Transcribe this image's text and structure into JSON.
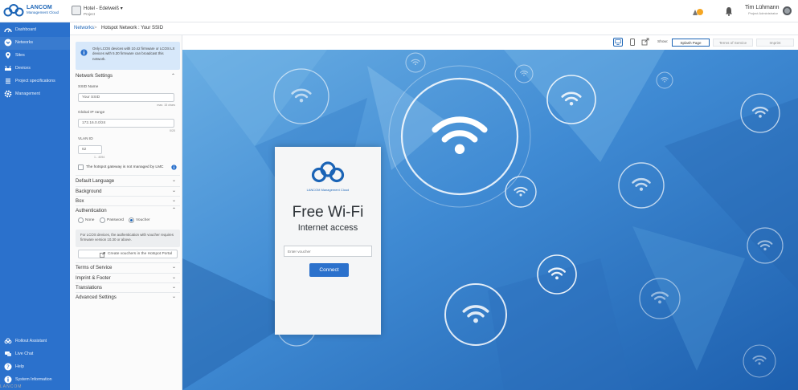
{
  "brand": {
    "title": "LANCOM",
    "subtitle": "Management Cloud"
  },
  "project": {
    "name": "Hotel - Edelweiß",
    "type": "Project"
  },
  "user": {
    "name": "Tim Lühmann",
    "role": "Project Administrator"
  },
  "sidebar": {
    "items": [
      {
        "label": "Dashboard",
        "icon": "dashboard-icon"
      },
      {
        "label": "Networks",
        "icon": "networks-icon"
      },
      {
        "label": "Sites",
        "icon": "pin-icon"
      },
      {
        "label": "Devices",
        "icon": "devices-icon"
      },
      {
        "label": "Project specifications",
        "icon": "list-icon"
      },
      {
        "label": "Management",
        "icon": "gear-icon"
      }
    ],
    "bottom": [
      {
        "label": "Rollout Assistant",
        "icon": "cloud-icon"
      },
      {
        "label": "Live Chat",
        "icon": "chat-icon"
      },
      {
        "label": "Help",
        "icon": "help-icon"
      },
      {
        "label": "System Information",
        "icon": "info-icon"
      }
    ]
  },
  "breadcrumb": {
    "parent": "Networks",
    "separator": ">",
    "current": "Hotspot Network : Your SSID"
  },
  "panel": {
    "info_text": "Only LCOS devices with 10.42 firmware or LCOS LX devices with 5.30 firmware can broadcast this network.",
    "network_settings": {
      "title": "Network Settings",
      "ssid_label": "SSID Name",
      "ssid_value": "Your SSID",
      "ssid_hint": "max. 15 chars",
      "ip_label": "Global IP range",
      "ip_value": "172.16.0.0/24",
      "ip_hint": "0/20",
      "vlan_label": "VLAN ID",
      "vlan_value": "62",
      "vlan_hint": "1 - 4094",
      "gateway_checkbox": "The hotspot gateway is not managed by LMC"
    },
    "sections_top": [
      "Default Language",
      "Background",
      "Box"
    ],
    "authentication": {
      "title": "Authentication",
      "options": [
        "None",
        "Password",
        "Voucher"
      ],
      "selected": "Voucher",
      "note": "For LCOS devices, the authentication with voucher requires firmware version 10.30 or above.",
      "button": "Create vouchers in the Hotspot Portal"
    },
    "sections_bottom": [
      "Terms of Service",
      "Imprint & Footer",
      "Translations",
      "Advanced Settings"
    ]
  },
  "preview": {
    "show_label": "Show:",
    "tabs": [
      "Splash Page",
      "Terms of Service",
      "Imprint"
    ],
    "active_tab": "Splash Page",
    "card": {
      "brand": "LANCOM Management Cloud",
      "title": "Free Wi-Fi",
      "subtitle": "Internet access",
      "input_placeholder": "Enter voucher",
      "button": "Connect"
    }
  },
  "footer_text": "LANCOM",
  "colors": {
    "sidebar": "#2b71cc",
    "accent": "#1b64b6",
    "notification": "#f5a623"
  }
}
